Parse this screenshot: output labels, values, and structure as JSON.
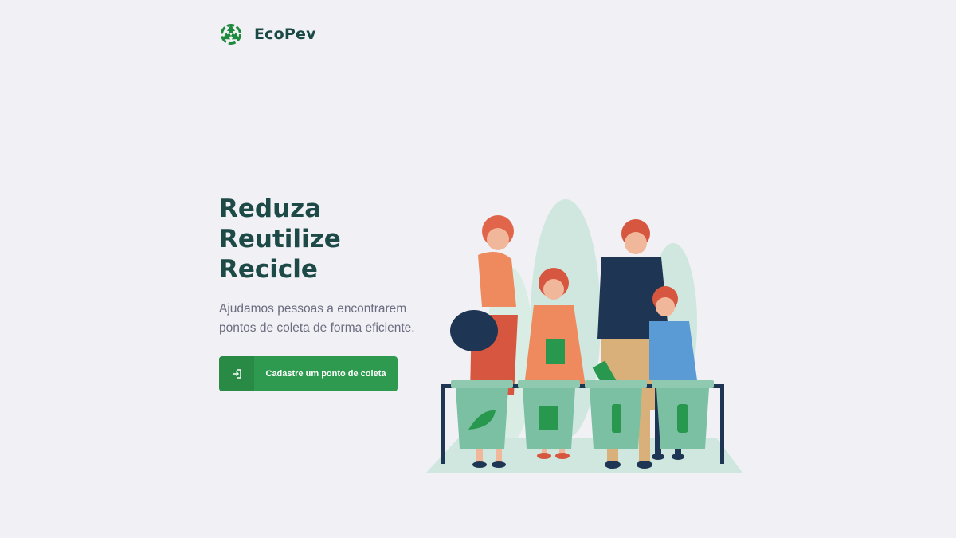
{
  "app": {
    "brand": "EcoPev",
    "logo_icon": "recycle-icon"
  },
  "hero": {
    "headline": [
      "Reduza",
      "Reutilize",
      "Recicle"
    ],
    "subtitle": "Ajudamos pessoas a encontrarem pontos de coleta de forma eficiente."
  },
  "cta": {
    "label": "Cadastre um ponto de coleta",
    "icon": "sign-in-icon"
  },
  "illustration": {
    "icon": "family-recycling-illustration"
  },
  "colors": {
    "background": "#f0f0f5",
    "accent": "#2e9a4f",
    "headline": "#1d4a47",
    "text": "#6c6c80"
  }
}
